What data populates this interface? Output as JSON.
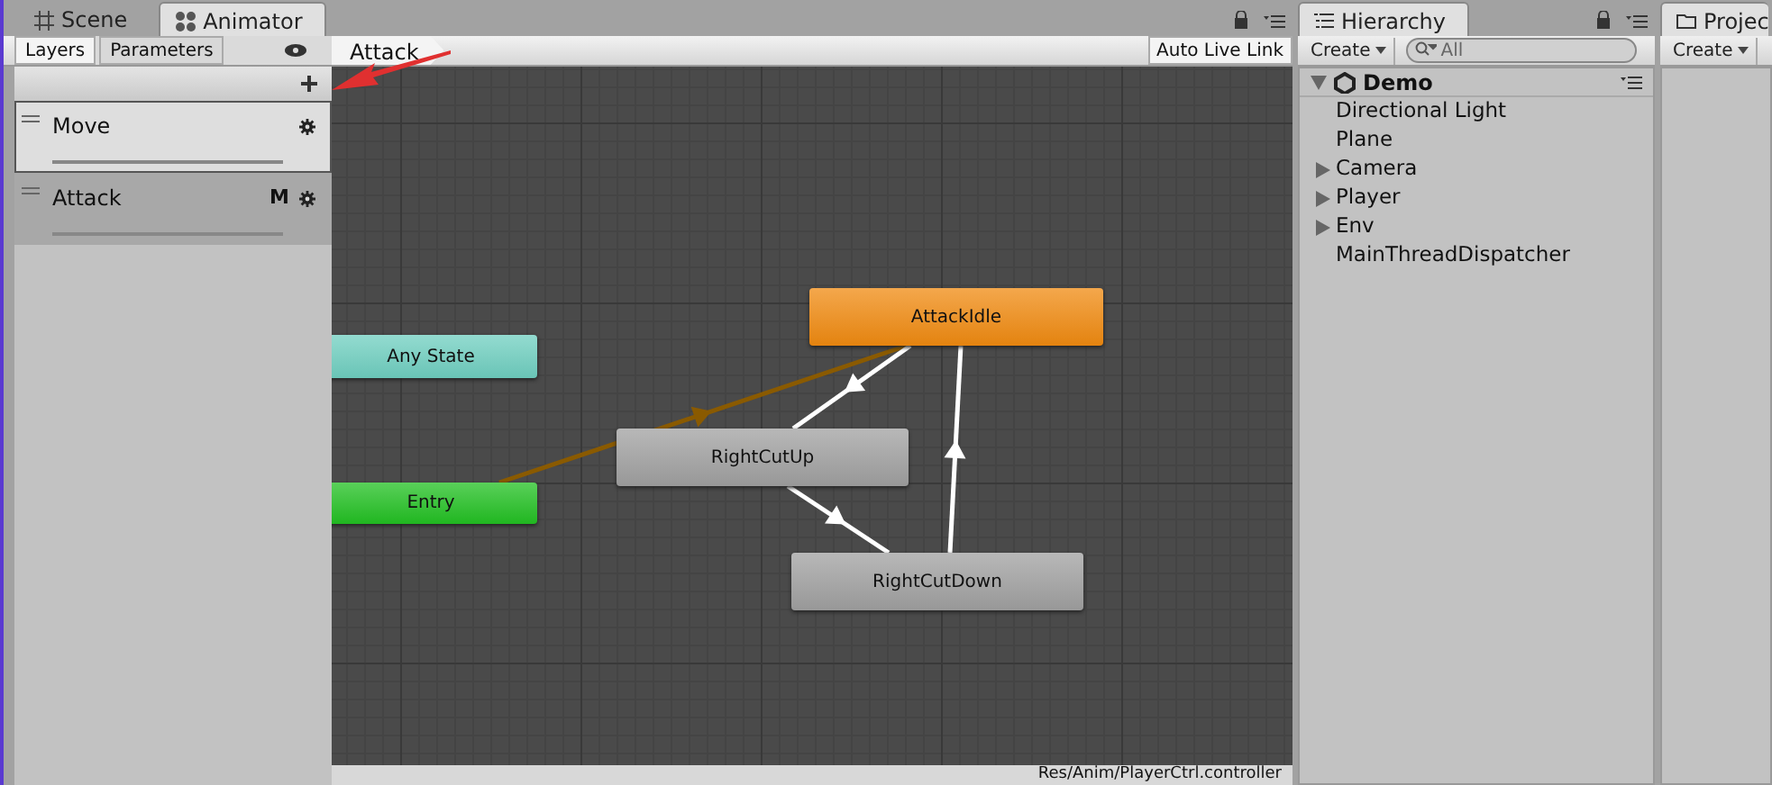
{
  "animator_tabs": [
    {
      "label": "Scene",
      "selected": false
    },
    {
      "label": "Animator",
      "selected": true
    }
  ],
  "side_tabs": [
    {
      "label": "Layers",
      "selected": true
    },
    {
      "label": "Parameters",
      "selected": false
    }
  ],
  "layers": [
    {
      "name": "Move",
      "selected": true
    },
    {
      "name": "Attack",
      "selected": false,
      "badge": "M"
    }
  ],
  "breadcrumb": "Attack",
  "live_link": "Auto Live Link",
  "states": [
    {
      "name": "AttackIdle",
      "color": "#f08a10"
    },
    {
      "name": "Any State",
      "color": "#6fcfc0"
    },
    {
      "name": "Entry",
      "color": "#22c022"
    },
    {
      "name": "RightCutUp",
      "color": "#a0a0a0"
    },
    {
      "name": "RightCutDown",
      "color": "#a0a0a0"
    }
  ],
  "status_bar": "Res/Anim/PlayerCtrl.controller",
  "hierarchy": {
    "tab": "Hierarchy",
    "create": "Create",
    "search_placeholder": "All",
    "scene": "Demo",
    "items": [
      {
        "name": "Directional Light"
      },
      {
        "name": "Plane"
      },
      {
        "name": "Camera",
        "expanded": false
      },
      {
        "name": "Player",
        "expanded": false
      },
      {
        "name": "Env",
        "expanded": false
      },
      {
        "name": "MainThreadDispatcher"
      }
    ]
  },
  "project": {
    "tab": "Projec",
    "create": "Create"
  }
}
